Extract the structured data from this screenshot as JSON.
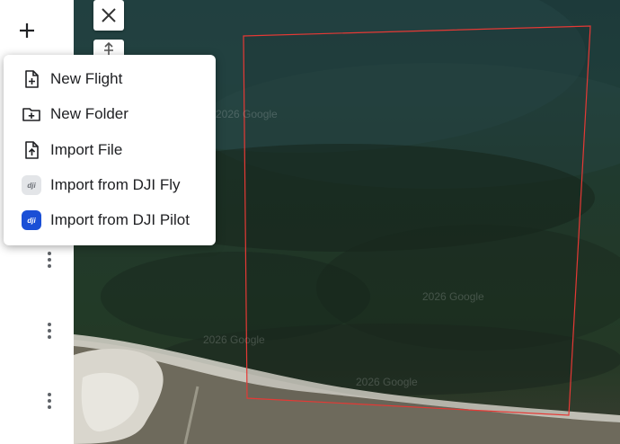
{
  "sidebar": {
    "add_icon": "plus-icon",
    "more_icon": "more-vertical-icon"
  },
  "map": {
    "watermark": "2026 Google",
    "close_icon": "close-icon",
    "tool_icon": "move-icon",
    "boundary_color": "#e53935"
  },
  "menu": {
    "items": [
      {
        "label": "New Flight",
        "icon": "new-file-icon"
      },
      {
        "label": "New Folder",
        "icon": "new-folder-icon"
      },
      {
        "label": "Import File",
        "icon": "upload-file-icon"
      },
      {
        "label": "Import from DJI Fly",
        "icon": "dji-fly-icon"
      },
      {
        "label": "Import from DJI Pilot",
        "icon": "dji-pilot-icon"
      }
    ],
    "dji_badge_text": "dji"
  }
}
